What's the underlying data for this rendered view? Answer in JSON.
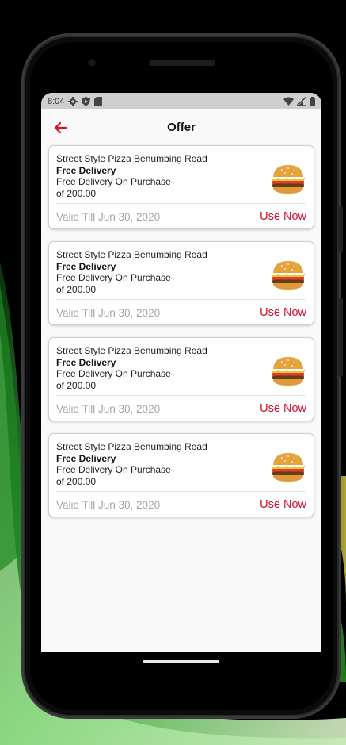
{
  "status_bar": {
    "time": "8:04",
    "icons": [
      "gear-icon",
      "shield-icon",
      "sd-card-icon",
      "wifi-icon",
      "signal-icon",
      "battery-icon"
    ]
  },
  "header": {
    "title": "Offer",
    "back_icon": "arrow-left-icon"
  },
  "colors": {
    "accent": "#d3112a",
    "muted_text": "#a8a8a8"
  },
  "offers": [
    {
      "store": "Street Style Pizza Benumbing Road",
      "type": "Free Delivery",
      "description_line1": "Free Delivery On Purchase",
      "description_line2": "of 200.00",
      "valid_till": "Valid Till Jun 30, 2020",
      "action": "Use Now",
      "image": "burger-icon"
    },
    {
      "store": "Street Style Pizza Benumbing Road",
      "type": "Free Delivery",
      "description_line1": "Free Delivery On Purchase",
      "description_line2": "of 200.00",
      "valid_till": "Valid Till Jun 30, 2020",
      "action": "Use Now",
      "image": "burger-icon"
    },
    {
      "store": "Street Style Pizza Benumbing Road",
      "type": "Free Delivery",
      "description_line1": "Free Delivery On Purchase",
      "description_line2": "of 200.00",
      "valid_till": "Valid Till Jun 30, 2020",
      "action": "Use Now",
      "image": "burger-icon"
    },
    {
      "store": "Street Style Pizza Benumbing Road",
      "type": "Free Delivery",
      "description_line1": "Free Delivery On Purchase",
      "description_line2": "of 200.00",
      "valid_till": "Valid Till Jun 30, 2020",
      "action": "Use Now",
      "image": "burger-icon"
    }
  ]
}
